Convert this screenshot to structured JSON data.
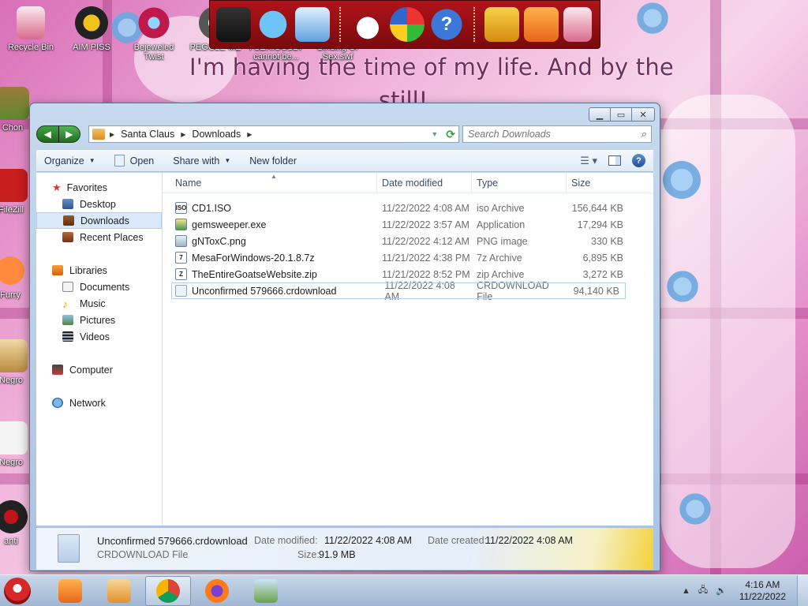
{
  "desktop": {
    "wallpaper_text_line1": "I'm having the time of my life. And by the",
    "wallpaper_text_line2": "still!",
    "icons": [
      {
        "label": "Recycle Bin"
      },
      {
        "label": "AIM PISS"
      },
      {
        "label": "Bejeweled Twist"
      },
      {
        "label": "PEGGLE ME"
      },
      {
        "label": "I SERIOUSLY cannot be..."
      },
      {
        "label": "Binding Of Sex.swf"
      },
      {
        "label": "Chon"
      },
      {
        "label": "FileZill"
      },
      {
        "label": "Furry"
      },
      {
        "label": "Negro"
      },
      {
        "label": "Negro"
      },
      {
        "label": "anti"
      }
    ]
  },
  "window": {
    "breadcrumb": [
      "Santa Claus",
      "Downloads"
    ],
    "search_placeholder": "Search Downloads",
    "toolbar": {
      "organize": "Organize",
      "open": "Open",
      "share_with": "Share with",
      "new_folder": "New folder"
    },
    "nav": {
      "favorites": "Favorites",
      "desktop": "Desktop",
      "downloads": "Downloads",
      "recent_places": "Recent Places",
      "libraries": "Libraries",
      "documents": "Documents",
      "music": "Music",
      "pictures": "Pictures",
      "videos": "Videos",
      "computer": "Computer",
      "network": "Network"
    },
    "columns": {
      "name": "Name",
      "date_modified": "Date modified",
      "type": "Type",
      "size": "Size"
    },
    "files": [
      {
        "name": "CD1.ISO",
        "date": "11/22/2022 4:08 AM",
        "type": "iso Archive",
        "size": "156,644 KB"
      },
      {
        "name": "gemsweeper.exe",
        "date": "11/22/2022 3:57 AM",
        "type": "Application",
        "size": "17,294 KB"
      },
      {
        "name": "gNToxC.png",
        "date": "11/22/2022 4:12 AM",
        "type": "PNG image",
        "size": "330 KB"
      },
      {
        "name": "MesaForWindows-20.1.8.7z",
        "date": "11/21/2022 4:38 PM",
        "type": "7z Archive",
        "size": "6,895 KB"
      },
      {
        "name": "TheEntireGoatseWebsite.zip",
        "date": "11/21/2022 8:52 PM",
        "type": "zip Archive",
        "size": "3,272 KB"
      },
      {
        "name": "Unconfirmed 579666.crdownload",
        "date": "11/22/2022 4:08 AM",
        "type": "CRDOWNLOAD File",
        "size": "94,140 KB"
      }
    ],
    "details": {
      "name": "Unconfirmed 579666.crdownload",
      "type": "CRDOWNLOAD File",
      "date_modified_label": "Date modified:",
      "date_modified": "11/22/2022 4:08 AM",
      "size_label": "Size:",
      "size": "91.9 MB",
      "date_created_label": "Date created:",
      "date_created": "11/22/2022 4:08 AM"
    }
  },
  "taskbar": {
    "time": "4:16 AM",
    "date": "11/22/2022"
  },
  "colors": {
    "dock": "#b0141a",
    "selection": "#d9e8fb",
    "window_frame": "#a9c3e2"
  }
}
